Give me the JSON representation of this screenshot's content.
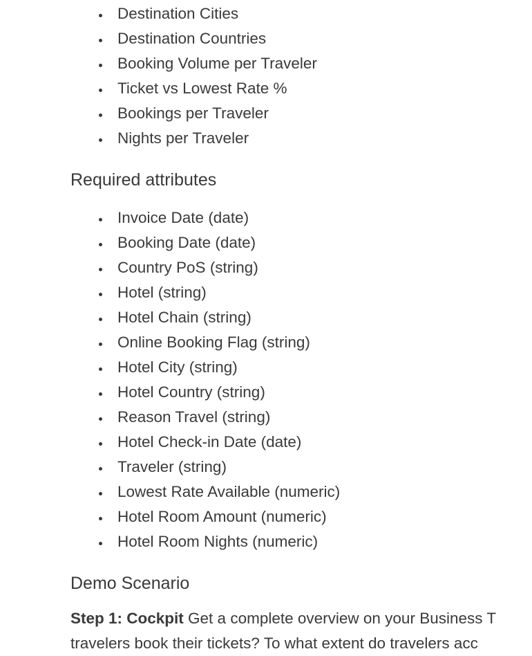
{
  "list1": {
    "items": [
      "Destination Cities",
      "Destination Countries",
      "Booking Volume per Traveler",
      "Ticket vs Lowest Rate %",
      "Bookings per Traveler",
      "Nights per Traveler"
    ]
  },
  "heading_required": "Required attributes",
  "list2": {
    "items": [
      "Invoice Date (date)",
      "Booking Date (date)",
      "Country PoS (string)",
      "Hotel (string)",
      "Hotel Chain (string)",
      "Online Booking Flag (string)",
      "Hotel City (string)",
      "Hotel Country (string)",
      "Reason Travel (string)",
      "Hotel Check-in Date (date)",
      "Traveler (string)",
      "Lowest Rate Available (numeric)",
      "Hotel Room Amount (numeric)",
      "Hotel Room Nights (numeric)"
    ]
  },
  "heading_demo": "Demo Scenario",
  "step1": {
    "label": "Step 1: Cockpit",
    "text_line1": " Get a complete overview on your Business T",
    "text_line2": "travelers book their tickets? To what extent do travelers acc"
  }
}
